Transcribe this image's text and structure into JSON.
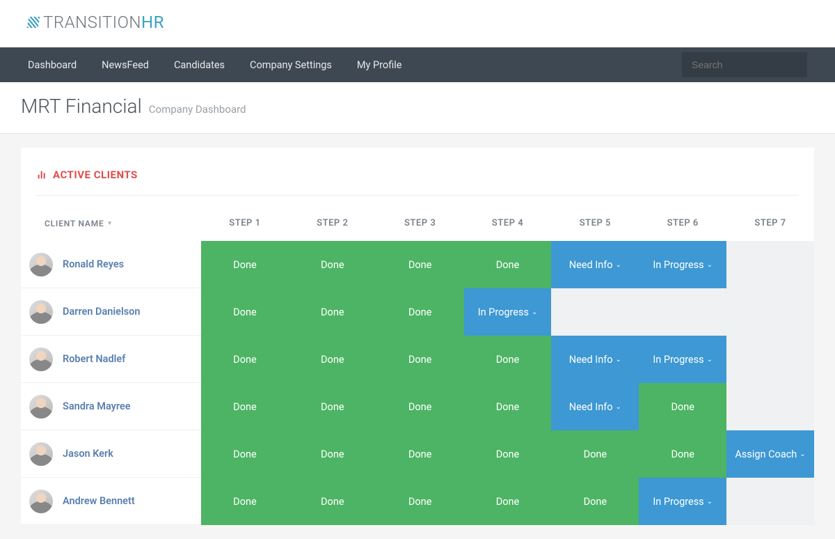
{
  "logo": {
    "part1": "TRANSITION",
    "part2": "HR"
  },
  "nav": {
    "items": [
      "Dashboard",
      "NewsFeed",
      "Candidates",
      "Company Settings",
      "My Profile"
    ],
    "search_placeholder": "Search"
  },
  "page": {
    "company": "MRT Financial",
    "subtitle": "Company Dashboard"
  },
  "section": {
    "title": "ACTIVE CLIENTS"
  },
  "table": {
    "columns": [
      "CLIENT NAME",
      "STEP 1",
      "STEP 2",
      "STEP 3",
      "STEP 4",
      "STEP 5",
      "STEP 6",
      "STEP 7"
    ],
    "status_labels": {
      "done": "Done",
      "in_progress": "In Progress",
      "need_info": "Need Info",
      "assign_coach": "Assign Coach"
    },
    "rows": [
      {
        "name": "Ronald Reyes",
        "steps": [
          "done",
          "done",
          "done",
          "done",
          "need_info",
          "in_progress",
          ""
        ]
      },
      {
        "name": "Darren Danielson",
        "steps": [
          "done",
          "done",
          "done",
          "in_progress",
          "",
          "",
          ""
        ]
      },
      {
        "name": "Robert Nadlef",
        "steps": [
          "done",
          "done",
          "done",
          "done",
          "need_info",
          "in_progress",
          ""
        ]
      },
      {
        "name": "Sandra Mayree",
        "steps": [
          "done",
          "done",
          "done",
          "done",
          "need_info",
          "done",
          ""
        ]
      },
      {
        "name": "Jason Kerk",
        "steps": [
          "done",
          "done",
          "done",
          "done",
          "done",
          "done",
          "assign_coach"
        ]
      },
      {
        "name": "Andrew Bennett",
        "steps": [
          "done",
          "done",
          "done",
          "done",
          "done",
          "in_progress",
          ""
        ]
      }
    ]
  }
}
